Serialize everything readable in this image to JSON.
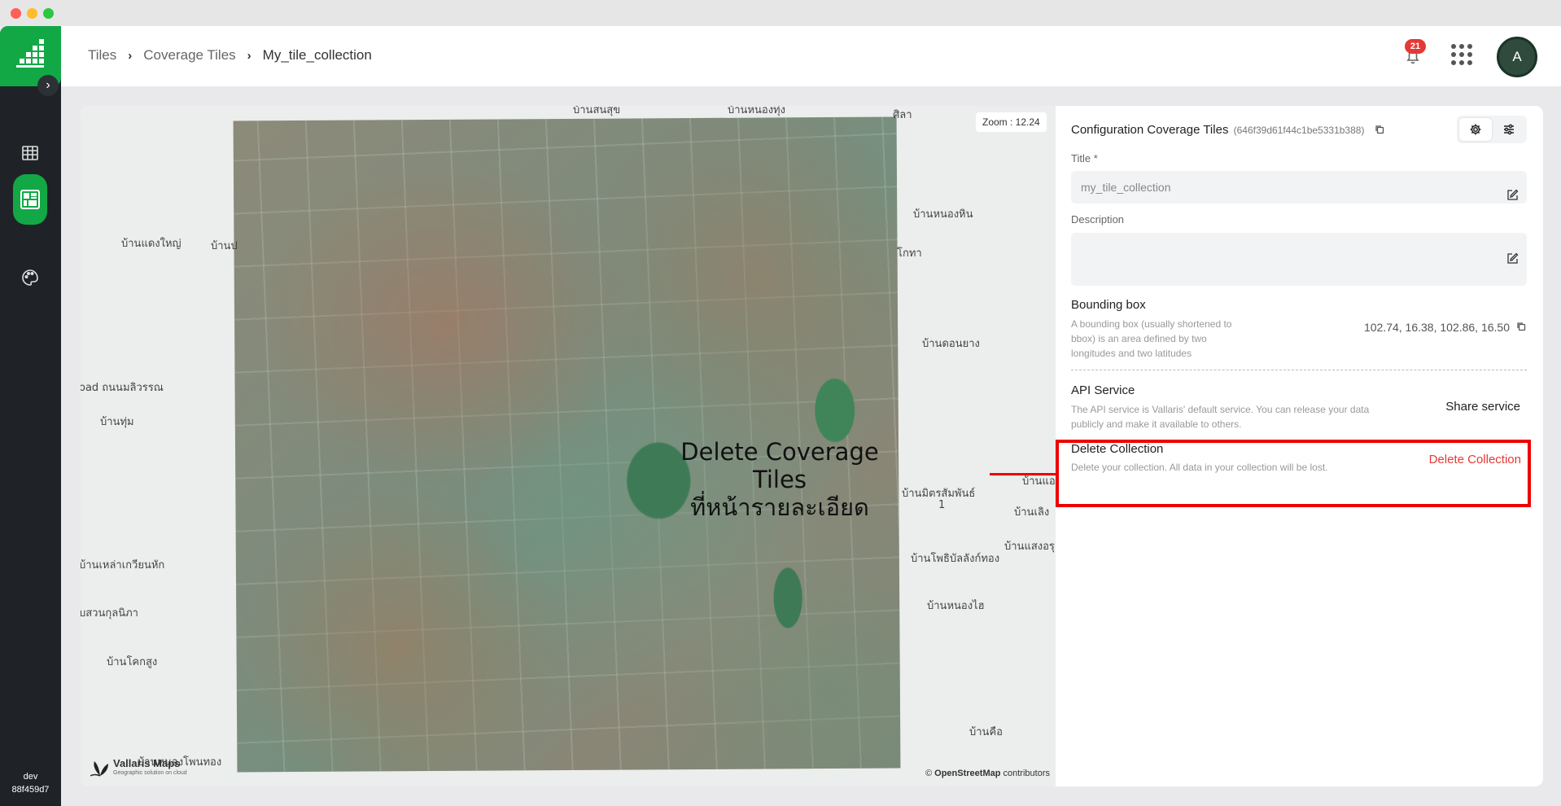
{
  "window": {
    "controls": [
      "close",
      "minimize",
      "maximize"
    ]
  },
  "sidebar": {
    "items": [
      {
        "icon": "table-grid-icon",
        "active": false
      },
      {
        "icon": "coverage-tiles-icon",
        "active": true
      },
      {
        "icon": "palette-icon",
        "active": false
      }
    ],
    "env_name": "dev",
    "env_hash": "88f459d7"
  },
  "breadcrumb": {
    "items": [
      "Tiles",
      "Coverage Tiles",
      "My_tile_collection"
    ]
  },
  "header": {
    "notification_count": "21",
    "avatar_initial": "A"
  },
  "map": {
    "zoom_label": "Zoom : 12.24",
    "annotation_line1": "Delete Coverage Tiles",
    "annotation_line2": "ที่หน้ารายละเอียด",
    "places": [
      "บ้านสนสุข",
      "บ้านหนองทุ่ง",
      "ศิลา",
      "บ้านหนองหิน",
      "บ้านแดงใหญ่",
      "บ้านป",
      "โกทา",
      "บ้านดอนยาง",
      "oad ถนนมลิวรรณ",
      "บ้านทุ่ม",
      "บ้านแอ",
      "บ้านมิตรสัมพันธ์",
      "1",
      "บ้านเลิง",
      "บ้านแสงอรุ",
      "บ้านโพธิบัลลังก์ทอง",
      "บ้านเหล่าเกวียนหัก",
      "บ้านหนองไฮ",
      "บสวนกุลนิภา",
      "บ้านโคกสูง",
      "บ้านคือ",
      "บ้านหนองโพนทอง"
    ],
    "brand_name": "Vallaris Maps",
    "brand_tagline": "Geographic solution on cloud",
    "attribution_prefix": "©",
    "attribution_link": "OpenStreetMap",
    "attribution_suffix": "contributors"
  },
  "panel": {
    "title": "Configuration Coverage Tiles",
    "collection_id": "(646f39d61f44c1be5331b388)",
    "title_label": "Title *",
    "title_value": "my_tile_collection",
    "description_label": "Description",
    "description_value": "",
    "bbox_title": "Bounding box",
    "bbox_desc": "A bounding box (usually shortened to bbox) is an area defined by two longitudes and two latitudes",
    "bbox_value": "102.74, 16.38, 102.86, 16.50",
    "api_title": "API Service",
    "api_desc": "The API service is Vallaris' default service. You can release your data publicly and make it available to others.",
    "share_label": "Share service",
    "delete_title": "Delete Collection",
    "delete_desc": "Delete your collection. All data in your collection will be lost.",
    "delete_label": "Delete Collection"
  },
  "colors": {
    "brand_green": "#12a846",
    "sidebar_bg": "#1f2327",
    "danger": "#e53935",
    "highlight": "#ee0000"
  }
}
